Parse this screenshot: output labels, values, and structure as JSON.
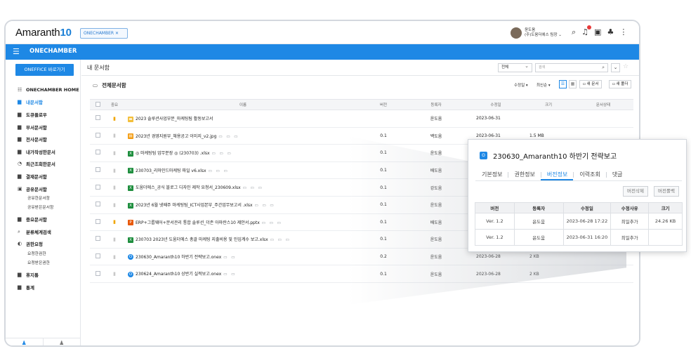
{
  "app": {
    "logo_text": "Amaranth",
    "logo_num": "10",
    "tab_chip": "ONECHAMBER ✕"
  },
  "user": {
    "name": "윤도움",
    "org": "(주)도움더에스 팀장 ⌄"
  },
  "header": {
    "title": "ONECHAMBER"
  },
  "sidebar": {
    "oneoffice_button": "ONEFFICE 바로가기",
    "items": [
      {
        "icon": "☷",
        "label": "ONECHAMBER HOME",
        "active": false
      },
      {
        "icon": "▆",
        "label": "내문서함",
        "active": true
      },
      {
        "icon": "▆",
        "label": "도큐플로우",
        "active": false
      },
      {
        "icon": "▆",
        "label": "부서문서함",
        "active": false
      },
      {
        "icon": "▆",
        "label": "전사문서함",
        "active": false
      },
      {
        "icon": "▆",
        "label": "내가작성한문서",
        "active": false
      },
      {
        "icon": "◔",
        "label": "최근조회한문서",
        "active": false
      },
      {
        "icon": "▆",
        "label": "결재문서함",
        "active": false
      },
      {
        "icon": "▣",
        "label": "공유문서함",
        "active": false
      }
    ],
    "shared_sub": [
      "공유한문서함",
      "공유받은문서함"
    ],
    "items2": [
      {
        "icon": "▆",
        "label": "중요문서함"
      },
      {
        "icon": "⌕",
        "label": "분류체계검색"
      },
      {
        "icon": "◐",
        "label": "권한요청"
      }
    ],
    "perm_sub": [
      "요청한권한",
      "요청받은권한"
    ],
    "items3": [
      {
        "icon": "▆",
        "label": "휴지통"
      },
      {
        "icon": "▆",
        "label": "통계"
      }
    ]
  },
  "main": {
    "title": "내 문서함",
    "scope_select": "전체",
    "search_placeholder": "검색",
    "folder_title": "전체문서함",
    "sort1": "수정일 ▾",
    "sort2": "최신순 ▾",
    "new_doc": "새 문서",
    "new_folder": "새 폴더"
  },
  "table": {
    "columns": [
      "중요",
      "이름",
      "버전",
      "등록자",
      "수정일",
      "크기",
      "문서상태"
    ],
    "rows": [
      {
        "starred": true,
        "type": "folder",
        "type_glyph": "▬",
        "name": "2023 솔루션사업부문_마케팅팀 활동보고서",
        "icons": "",
        "version": "",
        "registrant": "윤도움",
        "modified": "2023-06-31",
        "size": ""
      },
      {
        "starred": false,
        "type": "img",
        "type_glyph": "▤",
        "name": "2023년 경영지원부_채용공고 이미지_v2.jpg",
        "icons": "▭ ▭ ▭",
        "version": "0.1",
        "registrant": "백도움",
        "modified": "2023-06-31",
        "size": "1.5 MB"
      },
      {
        "starred": false,
        "type": "xls",
        "type_glyph": "X",
        "name": "◎ 마케팅팀 업무분장 ◎ (230703) .xlsx",
        "icons": "▭ ▭ ▭",
        "version": "0.1",
        "registrant": "윤도움",
        "modified": "",
        "size": ""
      },
      {
        "starred": false,
        "type": "xls",
        "type_glyph": "X",
        "name": "230703_리마인드마케팅 파일 v6.xlsx",
        "icons": "▭ ▭ ▭",
        "version": "0.1",
        "registrant": "배도움",
        "modified": "",
        "size": ""
      },
      {
        "starred": false,
        "type": "xls",
        "type_glyph": "X",
        "name": "도움더에스_공식 블로그 디자인 제작 요청서_230609.xlsx",
        "icons": "▭ ▭ ▭",
        "version": "0.1",
        "registrant": "강도움",
        "modified": "",
        "size": ""
      },
      {
        "starred": false,
        "type": "xls",
        "type_glyph": "X",
        "name": "2023년 6월 넷째주 마케팅팀_ICT사업본부_주간업무보고서 .xlsx",
        "icons": "▭ ▭ ▭",
        "version": "0.1",
        "registrant": "윤도움",
        "modified": "",
        "size": ""
      },
      {
        "starred": true,
        "type": "ppt",
        "type_glyph": "P",
        "name": "ERP+그룹웨어+문서관리 통합 솔루션_더존 아마란스10 제안서.pptx",
        "icons": "▭ ▭ ▭",
        "version": "0.1",
        "registrant": "배도움",
        "modified": "",
        "size": ""
      },
      {
        "starred": false,
        "type": "xls",
        "type_glyph": "X",
        "name": "230703 2023년 도움더에스 총괄 마케팅 지출비용 및 인입계수 보고.xlsx",
        "icons": "▭ ▭ ▭",
        "version": "0.1",
        "registrant": "윤도움",
        "modified": "",
        "size": ""
      },
      {
        "starred": false,
        "type": "onex",
        "type_glyph": "O",
        "name": "230630_Amaranth10 하반기 전략보고.onex",
        "icons": "▭ ▭",
        "version": "0.2",
        "registrant": "윤도움",
        "modified": "2023-06-28",
        "size": "2 KB"
      },
      {
        "starred": false,
        "type": "onex",
        "type_glyph": "O",
        "name": "230624_Amaranth10 상반기 실적보고.onex",
        "icons": "▭ ▭",
        "version": "0.1",
        "registrant": "윤도움",
        "modified": "2023-06-28",
        "size": "2 KB"
      }
    ]
  },
  "popup": {
    "title": "230630_Amaranth10 하반기 전략보고",
    "tabs": [
      "기본정보",
      "권한정보",
      "버전정보",
      "이력조회",
      "댓글"
    ],
    "active_tab": "버전정보",
    "btn_delete": "버전삭제",
    "btn_rollback": "버전롤백",
    "columns": [
      "버전",
      "등록자",
      "수정일",
      "수정사유",
      "크기"
    ],
    "rows": [
      {
        "version": "Ver. 1.2",
        "registrant": "윤도움",
        "modified": "2023-06-28 17:22",
        "reason": "최일추가",
        "size": "24.26 KB"
      },
      {
        "version": "Ver. 1.2",
        "registrant": "윤도움",
        "modified": "2023-06-31 16:20",
        "reason": "최일추가",
        "size": ""
      }
    ]
  }
}
